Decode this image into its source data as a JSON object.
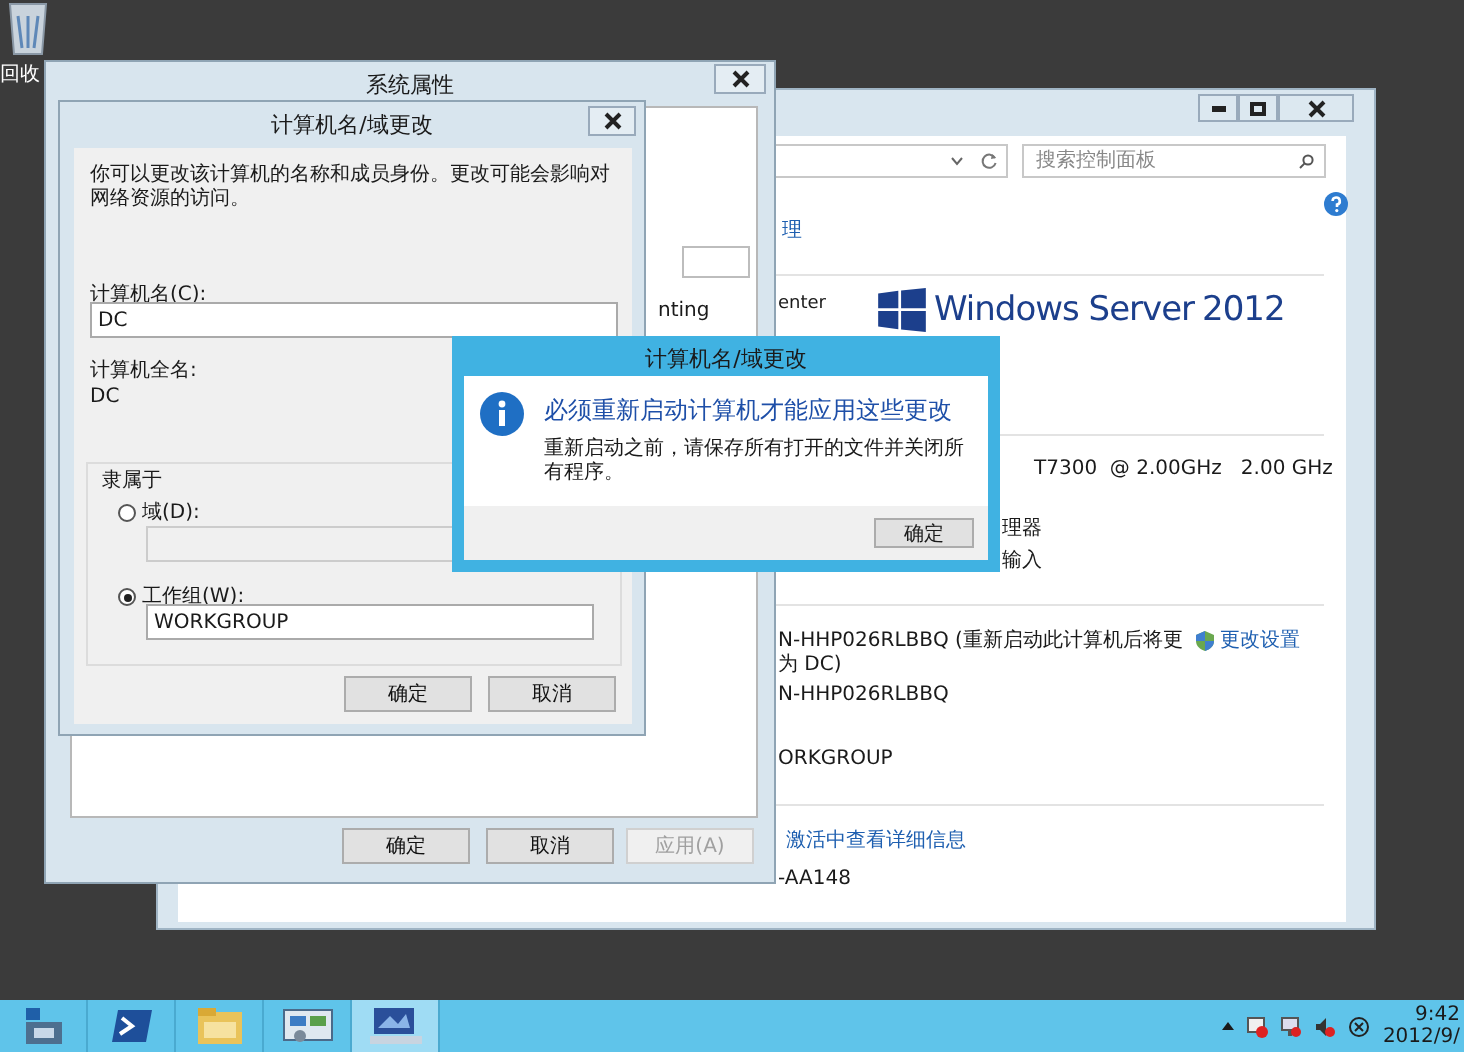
{
  "desktop": {
    "recycle_bin_label": "回收"
  },
  "control_panel": {
    "search": {
      "placeholder": "搜索控制面板"
    },
    "nav_link": "理",
    "edition_text": "enter",
    "logo_text": "Windows Server",
    "logo_year": "2012",
    "processor": "T7300  @ 2.00GHz   2.00 GHz",
    "memory_row": "理器",
    "pen_row": "输入",
    "computer_name": "N-HHP026RLBBQ (重新启动此计算机后将更",
    "computer_name_cont": "为 DC)",
    "change_settings": "更改设置",
    "full_name": "N-HHP026RLBBQ",
    "workgroup": "ORKGROUP",
    "activation_link": "激活中查看详细信息",
    "product_id": "-AA148"
  },
  "system_properties": {
    "title": "系统属性",
    "partial_text": "nting",
    "buttons": [
      {
        "label": "确定",
        "disabled": false
      },
      {
        "label": "取消",
        "disabled": false
      },
      {
        "label": "应用(A)",
        "disabled": true
      }
    ]
  },
  "name_dialog": {
    "title": "计算机名/域更改",
    "description": "你可以更改该计算机的名称和成员身份。更改可能会影响对网络资源的访问。",
    "computer_name_label": "计算机名(C):",
    "computer_name_value": "DC",
    "full_name_label": "计算机全名:",
    "full_name_value": "DC",
    "member_of": "隶属于",
    "options": [
      {
        "label": "域(D):",
        "selected": false,
        "field_disabled": true
      },
      {
        "label": "工作组(W):",
        "selected": true,
        "field_disabled": false,
        "value": "WORKGROUP"
      }
    ],
    "buttons": [
      "确定",
      "取消"
    ]
  },
  "message_box": {
    "title": "计算机名/域更改",
    "heading": "必须重新启动计算机才能应用这些更改",
    "body": "重新启动之前，请保存所有打开的文件并关闭所有程序。",
    "button": "确定"
  },
  "taskbar": {
    "apps": [
      {
        "kind": "server-manager",
        "selected": false
      },
      {
        "kind": "powershell",
        "selected": false
      },
      {
        "kind": "explorer",
        "selected": false
      },
      {
        "kind": "control-panel",
        "selected": false
      },
      {
        "kind": "system",
        "selected": true
      }
    ],
    "clock_time": "9:42",
    "clock_date": "2012/9/"
  }
}
